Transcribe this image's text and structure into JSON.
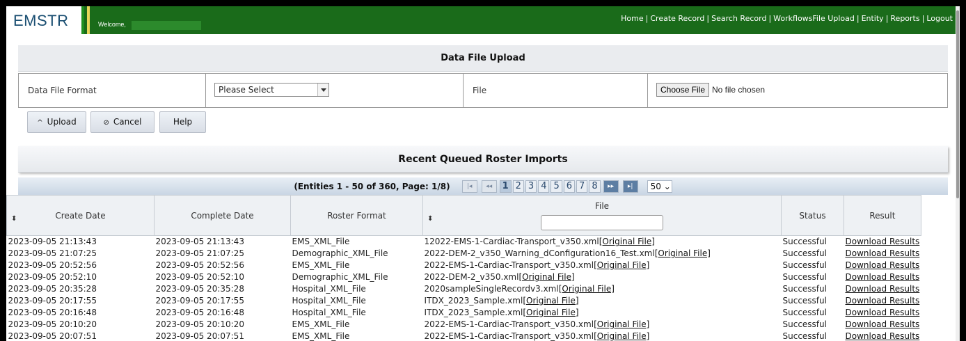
{
  "header": {
    "logo": "EMSTR",
    "welcome": "Welcome,",
    "nav": [
      "Home",
      "Create Record",
      "Search Record",
      "WorkflowsFile Upload",
      "Entity",
      "Reports",
      "Logout"
    ]
  },
  "upload": {
    "title": "Data File Upload",
    "format_label": "Data File Format",
    "format_value": "Please Select",
    "file_label": "File",
    "choose_file": "Choose File",
    "no_file": "No file chosen",
    "buttons": {
      "upload": "Upload",
      "cancel": "Cancel",
      "help": "Help"
    }
  },
  "roster": {
    "title": "Recent Queued Roster Imports",
    "pager_info": "(Entities 1 - 50 of 360, Page: 1/8)",
    "pages": [
      "1",
      "2",
      "3",
      "4",
      "5",
      "6",
      "7",
      "8"
    ],
    "per_page": "50",
    "columns": [
      "Create Date",
      "Complete Date",
      "Roster Format",
      "File",
      "Status",
      "Result"
    ],
    "rows": [
      {
        "create": "2023-09-05 21:13:43",
        "complete": "2023-09-05 21:13:43",
        "format": "EMS_XML_File",
        "file": "12022-EMS-1-Cardiac-Transport_v350.xml",
        "orig": "[Original File]",
        "status": "Successful",
        "result": "Download Results"
      },
      {
        "create": "2023-09-05 21:07:25",
        "complete": "2023-09-05 21:07:25",
        "format": "Demographic_XML_File",
        "file": "2022-DEM-2_v350_Warning_dConfiguration16_Test.xml",
        "orig": "[Original File]",
        "status": "Successful",
        "result": "Download Results"
      },
      {
        "create": "2023-09-05 20:52:56",
        "complete": "2023-09-05 20:52:56",
        "format": "EMS_XML_File",
        "file": "2022-EMS-1-Cardiac-Transport_v350.xml",
        "orig": "[Original File]",
        "status": "Successful",
        "result": "Download Results"
      },
      {
        "create": "2023-09-05 20:52:10",
        "complete": "2023-09-05 20:52:10",
        "format": "Demographic_XML_File",
        "file": "2022-DEM-2_v350.xml",
        "orig": "[Original File]",
        "status": "Successful",
        "result": "Download Results"
      },
      {
        "create": "2023-09-05 20:35:28",
        "complete": "2023-09-05 20:35:28",
        "format": "Hospital_XML_File",
        "file": "2020sampleSingleRecordv3.xml",
        "orig": "[Original File]",
        "status": "Successful",
        "result": "Download Results"
      },
      {
        "create": "2023-09-05 20:17:55",
        "complete": "2023-09-05 20:17:55",
        "format": "Hospital_XML_File",
        "file": "ITDX_2023_Sample.xml",
        "orig": "[Original File]",
        "status": "Successful",
        "result": "Download Results"
      },
      {
        "create": "2023-09-05 20:16:48",
        "complete": "2023-09-05 20:16:48",
        "format": "Hospital_XML_File",
        "file": "ITDX_2023_Sample.xml",
        "orig": "[Original File]",
        "status": "Successful",
        "result": "Download Results"
      },
      {
        "create": "2023-09-05 20:10:20",
        "complete": "2023-09-05 20:10:20",
        "format": "EMS_XML_File",
        "file": "2022-EMS-1-Cardiac-Transport_v350.xml",
        "orig": "[Original File]",
        "status": "Successful",
        "result": "Download Results"
      },
      {
        "create": "2023-09-05 20:07:51",
        "complete": "2023-09-05 20:07:51",
        "format": "EMS_XML_File",
        "file": "2022-EMS-1-Cardiac-Transport_v350.xml",
        "orig": "[Original File]",
        "status": "Successful",
        "result": "Download Results"
      }
    ]
  }
}
